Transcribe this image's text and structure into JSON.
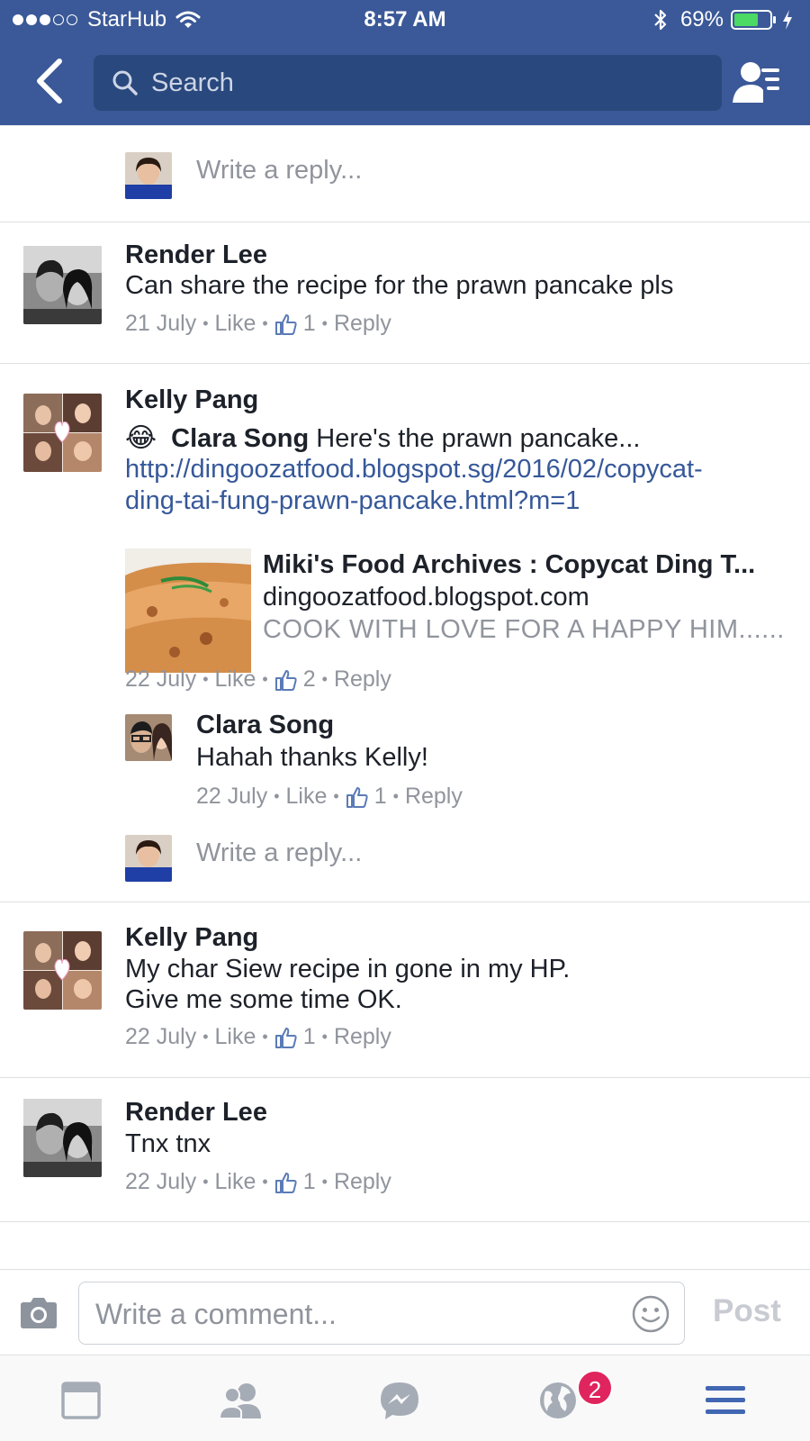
{
  "status_bar": {
    "carrier": "StarHub",
    "time": "8:57 AM",
    "battery": "69%",
    "battery_level": 0.69,
    "signal_bars": 3,
    "signal_total": 5
  },
  "nav": {
    "search_placeholder": "Search"
  },
  "comments": {
    "reply_prompt_1": "Write a reply...",
    "c1": {
      "name": "Render Lee",
      "text": "Can share the recipe for the prawn pancake pls",
      "date": "21 July",
      "like": "Like",
      "likes": "1",
      "reply": "Reply"
    },
    "c2": {
      "name": "Kelly Pang",
      "emoji": "😂",
      "mention": "Clara Song",
      "text": " Here's the prawn pancake...",
      "link_line1": "http://dingoozatfood.blogspot.sg/2016/02/copycat-",
      "link_line2": "ding-tai-fung-prawn-pancake.html?m=1",
      "preview": {
        "title": "Miki's Food Archives : Copycat Ding T...",
        "domain": "dingoozatfood.blogspot.com",
        "description": "COOK WITH LOVE FOR A HAPPY HIM......"
      },
      "date": "22 July",
      "like": "Like",
      "likes": "2",
      "reply": "Reply"
    },
    "c2_reply": {
      "name": "Clara Song",
      "text": "Hahah thanks Kelly!",
      "date": "22 July",
      "like": "Like",
      "likes": "1",
      "reply": "Reply"
    },
    "reply_prompt_2": "Write a reply...",
    "c3": {
      "name": "Kelly Pang",
      "line1": "My char Siew recipe in gone in my HP.",
      "line2": "Give me some time OK.",
      "date": "22 July",
      "like": "Like",
      "likes": "1",
      "reply": "Reply"
    },
    "c4": {
      "name": "Render Lee",
      "text": "Tnx tnx",
      "date": "22 July",
      "like": "Like",
      "likes": "1",
      "reply": "Reply"
    }
  },
  "composer": {
    "placeholder": "Write a comment...",
    "post_label": "Post"
  },
  "tabbar": {
    "notifications_badge": "2"
  },
  "colors": {
    "brand": "#3b5998",
    "link": "#365899",
    "badge": "#e0245e",
    "battery": "#4cd964"
  }
}
